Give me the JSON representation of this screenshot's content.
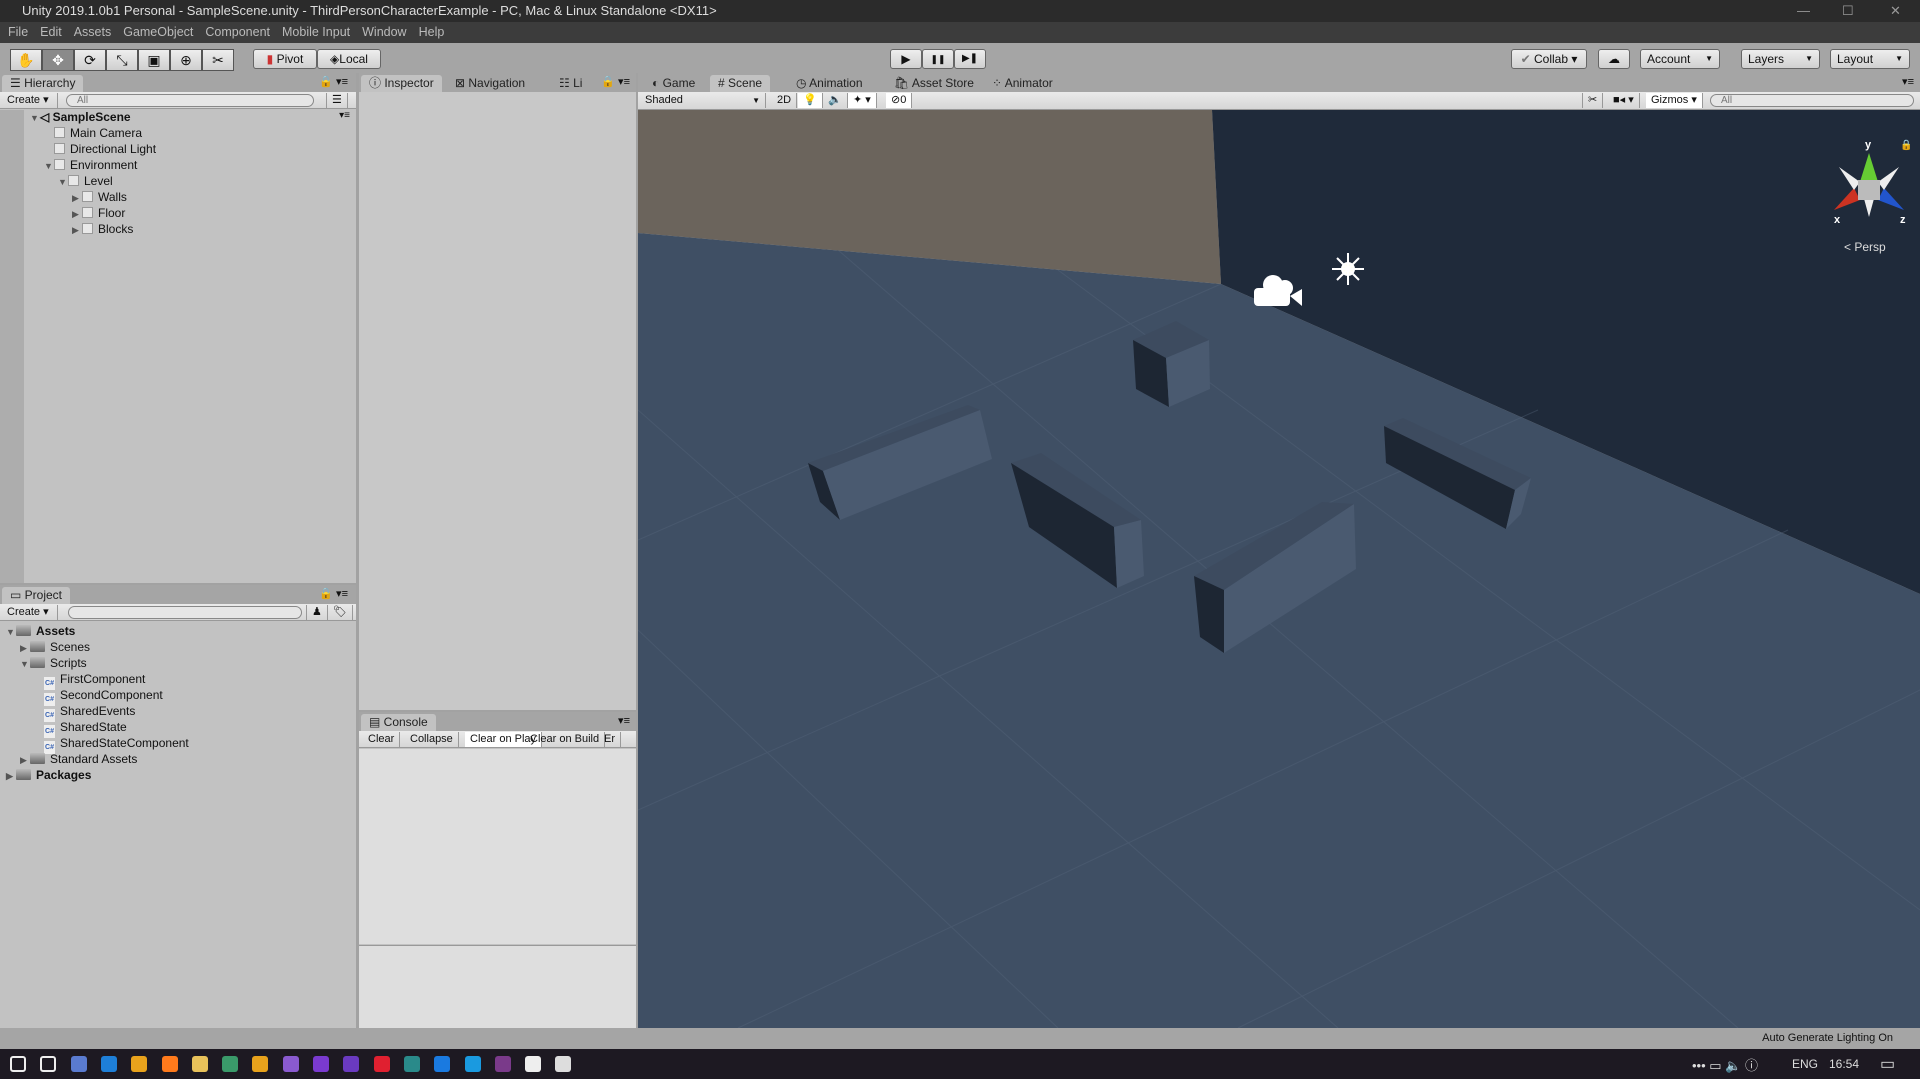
{
  "window": {
    "title": "Unity 2019.1.0b1 Personal - SampleScene.unity - ThirdPersonCharacterExample - PC, Mac & Linux Standalone <DX11>",
    "minimize": "—",
    "maximize": "☐",
    "close": "✕"
  },
  "menu": [
    "File",
    "Edit",
    "Assets",
    "GameObject",
    "Component",
    "Mobile Input",
    "Window",
    "Help"
  ],
  "toolbar": {
    "tools": [
      {
        "name": "hand",
        "glyph": "✋"
      },
      {
        "name": "move",
        "glyph": "✥"
      },
      {
        "name": "rotate",
        "glyph": "⟳"
      },
      {
        "name": "scale",
        "glyph": "⤡"
      },
      {
        "name": "rect",
        "glyph": "▣"
      },
      {
        "name": "transform",
        "glyph": "⊕"
      },
      {
        "name": "custom",
        "glyph": "✂"
      }
    ],
    "active_tool": "move",
    "pivot": "Pivot",
    "local": "Local",
    "play": "▶",
    "pause": "❚❚",
    "step": "▶❚",
    "collab": "Collab ▾",
    "cloud": "☁",
    "account": "Account",
    "layers": "Layers",
    "layout": "Layout"
  },
  "hierarchy": {
    "tab": "Hierarchy",
    "create": "Create ▾",
    "search_placeholder": "All",
    "scene": "SampleScene",
    "items": [
      {
        "label": "Main Camera",
        "depth": 1,
        "arrow": ""
      },
      {
        "label": "Directional Light",
        "depth": 1,
        "arrow": ""
      },
      {
        "label": "Environment",
        "depth": 1,
        "arrow": "▼"
      },
      {
        "label": "Level",
        "depth": 2,
        "arrow": "▼"
      },
      {
        "label": "Walls",
        "depth": 3,
        "arrow": "▶"
      },
      {
        "label": "Floor",
        "depth": 3,
        "arrow": "▶"
      },
      {
        "label": "Blocks",
        "depth": 3,
        "arrow": "▶"
      }
    ]
  },
  "project": {
    "tab": "Project",
    "create": "Create ▾",
    "items": [
      {
        "label": "Assets",
        "depth": 0,
        "arrow": "▼",
        "type": "folder",
        "bold": true
      },
      {
        "label": "Scenes",
        "depth": 1,
        "arrow": "▶",
        "type": "folder"
      },
      {
        "label": "Scripts",
        "depth": 1,
        "arrow": "▼",
        "type": "folder"
      },
      {
        "label": "FirstComponent",
        "depth": 2,
        "type": "script"
      },
      {
        "label": "SecondComponent",
        "depth": 2,
        "type": "script"
      },
      {
        "label": "SharedEvents",
        "depth": 2,
        "type": "script"
      },
      {
        "label": "SharedState",
        "depth": 2,
        "type": "script"
      },
      {
        "label": "SharedStateComponent",
        "depth": 2,
        "type": "script"
      },
      {
        "label": "Standard Assets",
        "depth": 1,
        "arrow": "▶",
        "type": "folder"
      },
      {
        "label": "Packages",
        "depth": 0,
        "arrow": "▶",
        "type": "folder",
        "bold": true
      }
    ]
  },
  "inspector": {
    "tabs": [
      "Inspector",
      "Navigation",
      "Li"
    ]
  },
  "console": {
    "tab": "Console",
    "buttons": [
      "Clear",
      "Collapse",
      "Clear on Play",
      "Clear on Build",
      "Er"
    ],
    "active": [
      "Clear on Play"
    ]
  },
  "scene": {
    "tabs": [
      "Game",
      "Scene",
      "Animation",
      "Asset Store",
      "Animator"
    ],
    "active_tab": "Scene",
    "shading": "Shaded",
    "mode2d": "2D",
    "hidden_count": "0",
    "gizmos": "Gizmos",
    "search_placeholder": "All",
    "projection": "Persp",
    "axes": {
      "x": "x",
      "y": "y",
      "z": "z"
    },
    "colors": {
      "floor": "#3f4f64",
      "wall": "#1f2a3a",
      "sky": "#6b645c"
    }
  },
  "status": {
    "lighting": "Auto Generate Lighting On"
  },
  "taskbar": {
    "lang": "ENG",
    "time": "16:54"
  }
}
